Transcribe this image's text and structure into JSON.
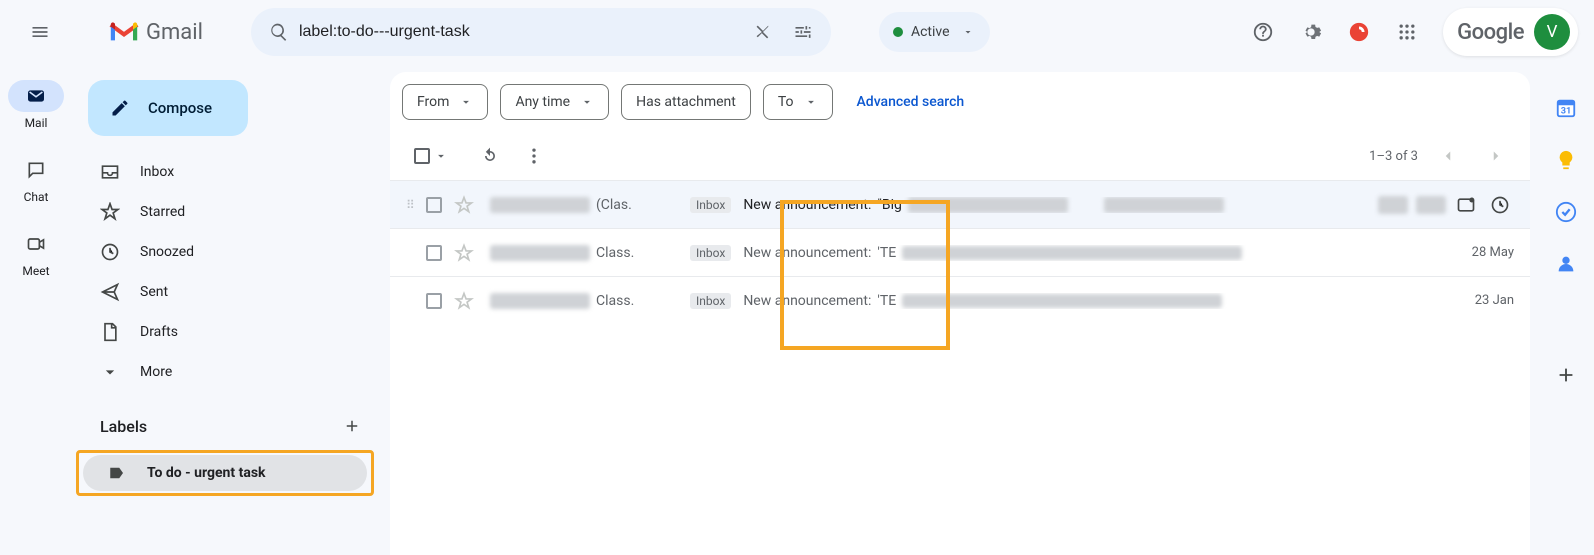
{
  "header": {
    "logo_text": "Gmail",
    "search_value": "label:to-do---urgent-task",
    "status_label": "Active",
    "google_label": "Google",
    "avatar_initial": "V"
  },
  "left_rail": {
    "mail": "Mail",
    "chat": "Chat",
    "meet": "Meet"
  },
  "sidebar": {
    "compose": "Compose",
    "items": {
      "inbox": "Inbox",
      "starred": "Starred",
      "snoozed": "Snoozed",
      "sent": "Sent",
      "drafts": "Drafts",
      "more": "More"
    },
    "labels_title": "Labels",
    "custom_label": "To do - urgent task"
  },
  "filters": {
    "from": "From",
    "any_time": "Any time",
    "has_attachment": "Has attachment",
    "to": "To",
    "advanced": "Advanced search"
  },
  "toolbar": {
    "pager_text": "1–3 of 3"
  },
  "mail_rows": {
    "inbox_badge": "Inbox",
    "subject_prefix": "New announcement:",
    "row1_sender_suffix": "(Clas.",
    "row1_subj_suffix": "\"Big",
    "row2_sender_suffix": "Class.",
    "row2_subj_suffix": "'TE",
    "row2_date": "28 May",
    "row3_sender_suffix": "Class.",
    "row3_subj_suffix": "'TE",
    "row3_date": "23 Jan"
  }
}
